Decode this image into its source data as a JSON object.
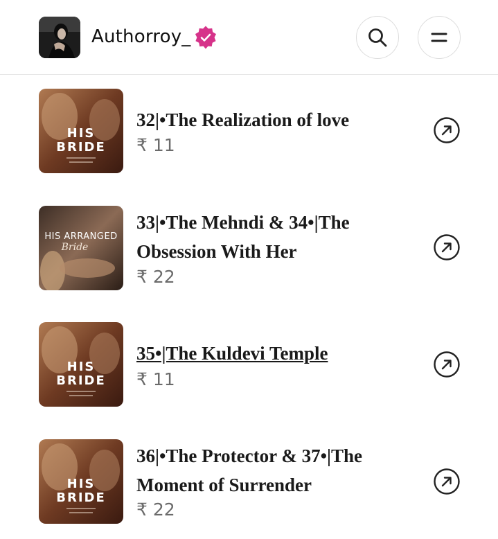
{
  "header": {
    "username": "Authorroy_",
    "verified_color": "#d6338a"
  },
  "episodes": [
    {
      "title": "32|•The Realization of love",
      "price": "₹ 11",
      "cover": "his-bride"
    },
    {
      "title": "33|•The Mehndi & 34•|The Obsession With Her",
      "price": "₹ 22",
      "cover": "his-arranged-bride"
    },
    {
      "title": "35•|The Kuldevi Temple",
      "price": "₹ 11",
      "cover": "his-bride"
    },
    {
      "title": "36|•The Protector & 37•|The Moment of Surrender",
      "price": "₹ 22",
      "cover": "his-bride"
    }
  ],
  "cover_text": {
    "his_bride_line1": "HIS",
    "his_bride_line2": "BRIDE",
    "arranged_line1": "HIS ARRANGED",
    "arranged_line2": "Bride"
  }
}
